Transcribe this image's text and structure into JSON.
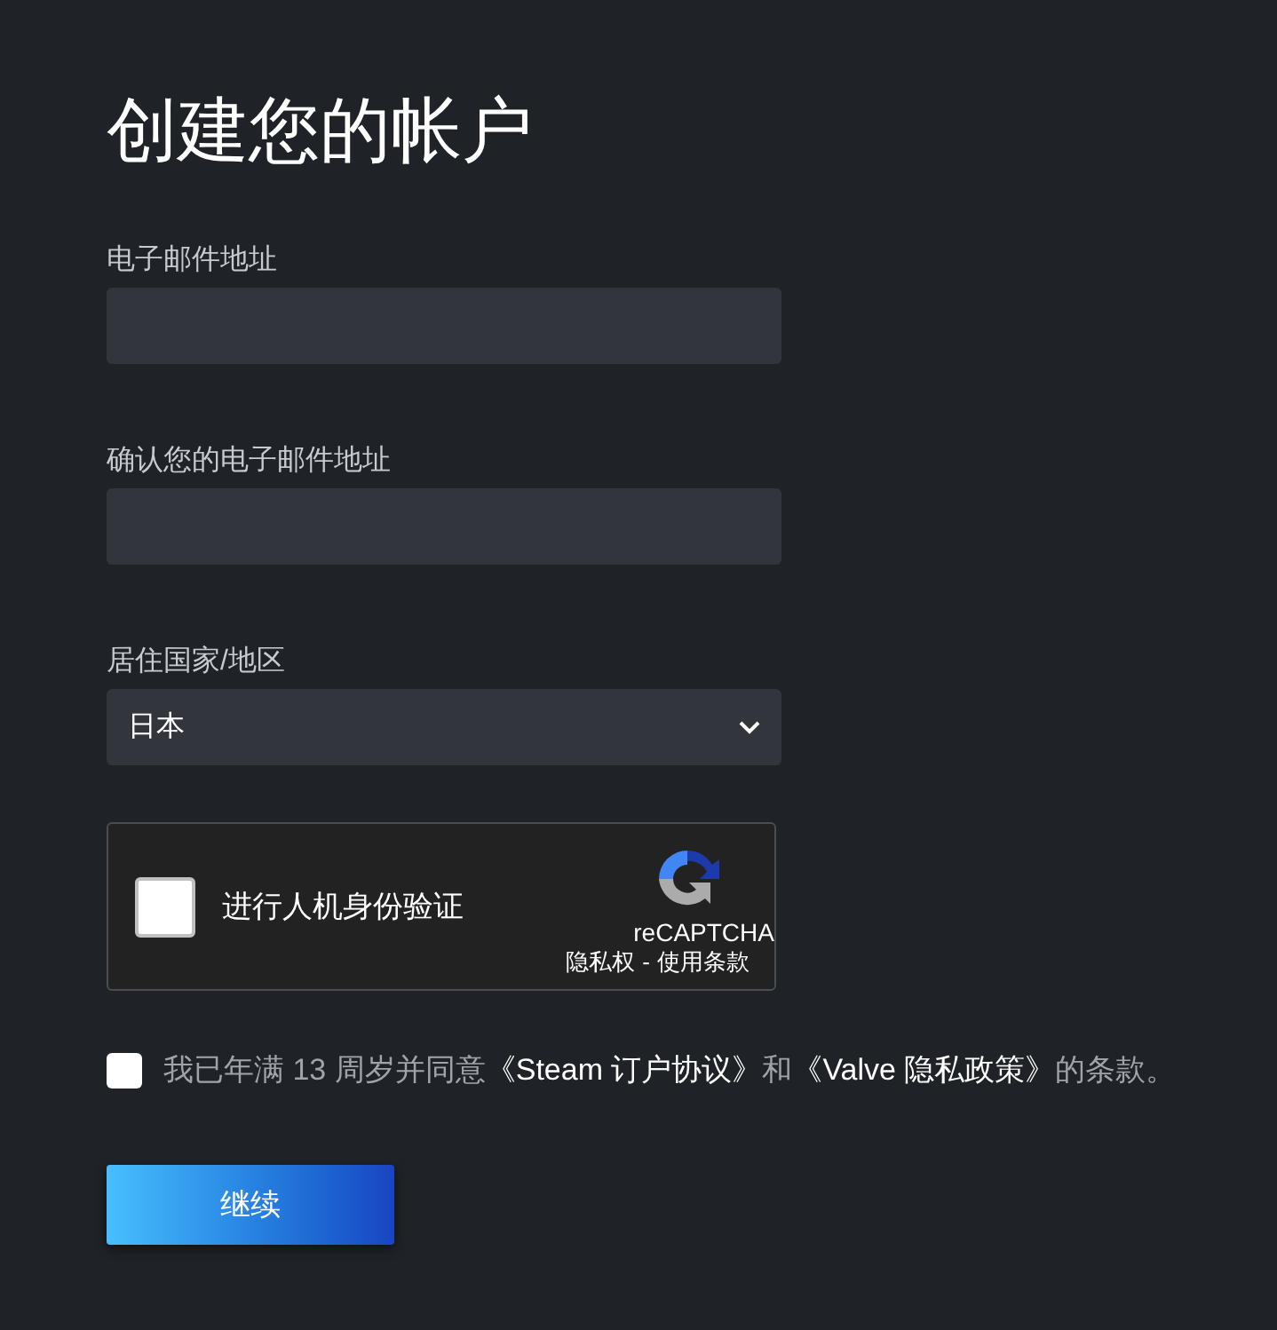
{
  "title": "创建您的帐户",
  "fields": [
    {
      "kind": "input",
      "label": "电子邮件地址"
    },
    {
      "kind": "input",
      "label": "确认您的电子邮件地址"
    },
    {
      "kind": "select",
      "label": "居住国家/地区",
      "value": "日本"
    }
  ],
  "captcha": {
    "checked": false,
    "label": "进行人机身份验证",
    "brand": "reCAPTCHA",
    "privacy": "隐私权",
    "separator": "-",
    "terms": "使用条款"
  },
  "agreement": {
    "checked": false,
    "parts": [
      {
        "kind": "text",
        "text": "我已年满 13 周岁并同意"
      },
      {
        "kind": "link",
        "text": "《Steam 订户协议》"
      },
      {
        "kind": "text",
        "text": "和"
      },
      {
        "kind": "link",
        "text": "《Valve 隐私政策》"
      },
      {
        "kind": "text",
        "text": "的条款。"
      }
    ]
  },
  "continue_button": "继续"
}
